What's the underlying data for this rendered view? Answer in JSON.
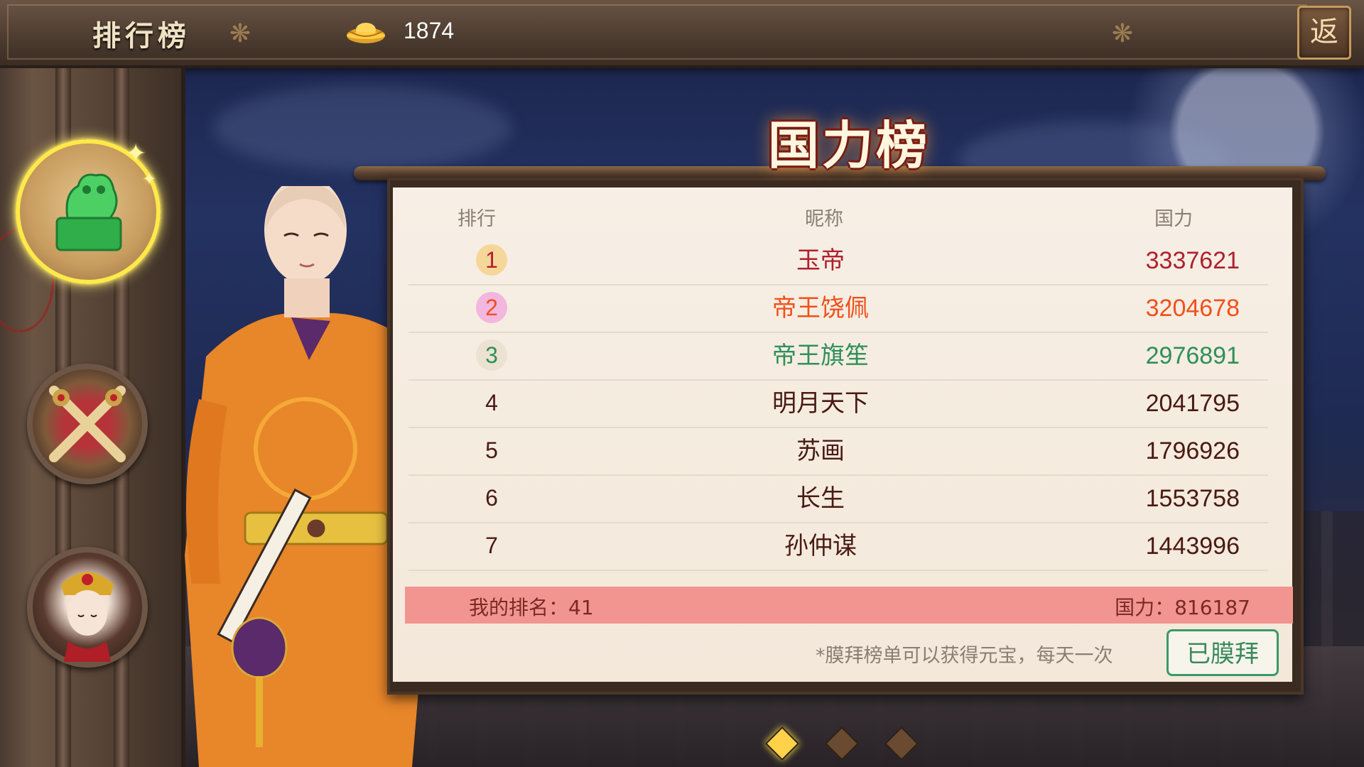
{
  "topbar": {
    "title": "排行榜",
    "gold_amount": "1874",
    "icons": [
      "gold-ingot-icon",
      "return-icon"
    ]
  },
  "back_button": {
    "label": "返"
  },
  "sidebar": {
    "items": [
      {
        "name": "power-seal",
        "icon": "jade-seal-icon",
        "selected": true
      },
      {
        "name": "battle",
        "icon": "crossed-swords-icon",
        "selected": false
      },
      {
        "name": "consort",
        "icon": "empress-portrait-icon",
        "selected": false
      }
    ]
  },
  "board": {
    "title": "国力榜",
    "headers": {
      "rank": "排行",
      "nickname": "昵称",
      "power": "国力"
    },
    "rows": [
      {
        "rank": "1",
        "nickname": "玉帝",
        "power": "3337621",
        "color": "#b0202e",
        "badge": "#f6d79a"
      },
      {
        "rank": "2",
        "nickname": "帝王饶佩",
        "power": "3204678",
        "color": "#f0501a",
        "badge": "#f2b6df"
      },
      {
        "rank": "3",
        "nickname": "帝王旗笙",
        "power": "2976891",
        "color": "#2f8f5a",
        "badge": "#ece2d2"
      },
      {
        "rank": "4",
        "nickname": "明月天下",
        "power": "2041795",
        "color": "#4a1a14",
        "badge": ""
      },
      {
        "rank": "5",
        "nickname": "苏画",
        "power": "1796926",
        "color": "#4a1a14",
        "badge": ""
      },
      {
        "rank": "6",
        "nickname": "长生",
        "power": "1553758",
        "color": "#4a1a14",
        "badge": ""
      },
      {
        "rank": "7",
        "nickname": "孙仲谋",
        "power": "1443996",
        "color": "#4a1a14",
        "badge": ""
      }
    ],
    "my_rank_label": "我的排名：41",
    "my_power_label": "国力：816187",
    "note": "*膜拜榜单可以获得元宝，每天一次",
    "worship_button": "已膜拜"
  },
  "pagination": {
    "pages": 3,
    "current": 1
  },
  "colors": {
    "accent_gold": "#ffe94a",
    "my_bar": "#f29590",
    "worship_green": "#3a9a66"
  }
}
